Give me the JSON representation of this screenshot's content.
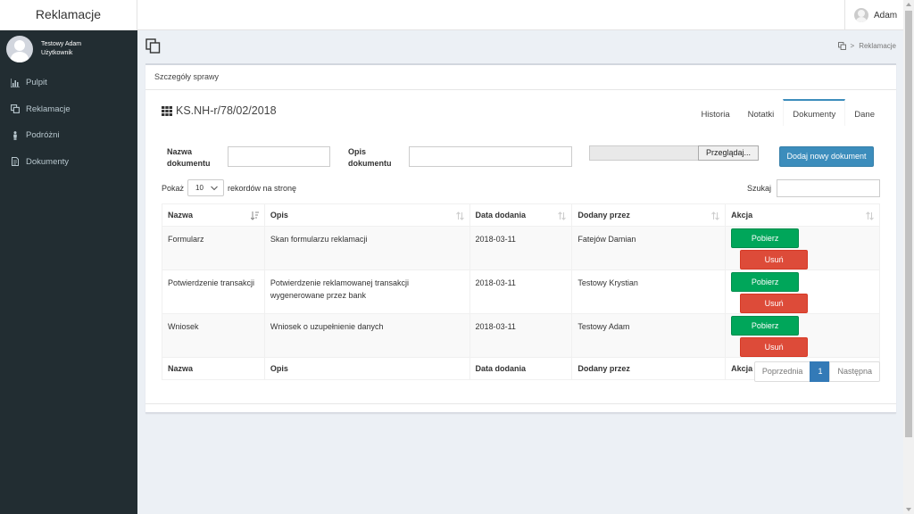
{
  "app": {
    "title": "Reklamacje"
  },
  "topnav": {
    "user_name": "Adam"
  },
  "sidebar": {
    "user_name": "Testowy Adam",
    "user_role": "Użytkownik",
    "items": [
      {
        "label": "Pulpit",
        "icon": "bar-chart-icon"
      },
      {
        "label": "Reklamacje",
        "icon": "copy-icon"
      },
      {
        "label": "Podróżni",
        "icon": "person-icon"
      },
      {
        "label": "Dokumenty",
        "icon": "document-icon"
      }
    ]
  },
  "breadcrumb": {
    "label": "Reklamacje"
  },
  "box": {
    "header": "Szczegóły sprawy",
    "case_number": "KS.NH-r/78/02/2018",
    "tabs": [
      "Historia",
      "Notatki",
      "Dokumenty",
      "Dane"
    ],
    "active_tab": "Dokumenty"
  },
  "form": {
    "name_label_1": "Nazwa",
    "name_label_2": "dokumentu",
    "name_value": "",
    "desc_label_1": "Opis",
    "desc_label_2": "dokumentu",
    "desc_value": "",
    "browse_label": "Przeglądaj...",
    "add_label": "Dodaj nowy dokument"
  },
  "table_controls": {
    "show_label": "Pokaż",
    "page_size": "10",
    "records_label": "rekordów na stronę",
    "search_label": "Szukaj",
    "search_value": ""
  },
  "table": {
    "columns": [
      "Nazwa",
      "Opis",
      "Data dodania",
      "Dodany przez",
      "Akcja"
    ],
    "rows": [
      {
        "name": "Formularz",
        "desc": "Skan formularzu reklamacji",
        "date": "2018-03-11",
        "by": "Fatejów Damian"
      },
      {
        "name": "Potwierdzenie transakcji",
        "desc": "Potwierdzenie reklamowanej transakcji wygenerowane przez bank",
        "date": "2018-03-11",
        "by": "Testowy Krystian"
      },
      {
        "name": "Wniosek",
        "desc": "Wniosek o uzupełnienie danych",
        "date": "2018-03-11",
        "by": "Testowy Adam"
      }
    ],
    "download_label": "Pobierz",
    "delete_label": "Usuń"
  },
  "pagination": {
    "prev": "Poprzednia",
    "current": "1",
    "next": "Następna"
  },
  "colors": {
    "sidebar": "#222d32",
    "primary": "#3c8dbc",
    "success": "#00a65a",
    "danger": "#dd4b39"
  }
}
